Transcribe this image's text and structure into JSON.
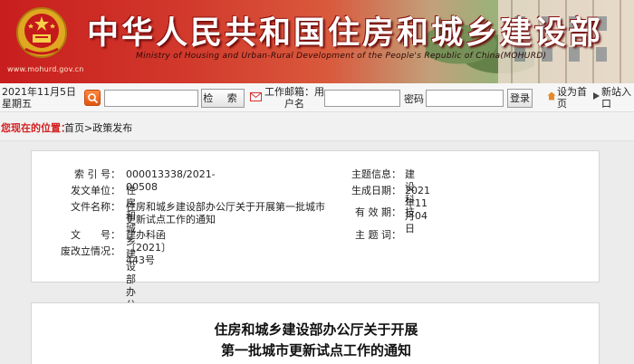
{
  "header": {
    "site_title": "中华人民共和国住房和城乡建设部",
    "site_subtitle": "Ministry of Housing and Urban-Rural Development of the People's Republic of China(MOHURD)",
    "site_url": "www.mohurd.gov.cn"
  },
  "utility_bar": {
    "date": "2021年11月5日 星期五",
    "search_placeholder": "",
    "search_button": "检 索",
    "mail_label": "工作邮箱：用户名",
    "password_label": "密码",
    "login_button": "登录",
    "set_home_label": "设为首页",
    "nav_label": "新站入口"
  },
  "breadcrumb": {
    "label": "您现在的位置：",
    "path": "首页>政策发布"
  },
  "info": {
    "index_key": "索 引 号：",
    "index_value": "000013338/2021-00508",
    "unit_key": "发文单位：",
    "unit_value": "住房和城乡建设部办公厅",
    "title_key": "文件名称：",
    "title_value": "住房和城乡建设部办公厅关于开展第一批城市更新试点工作的通知",
    "docno_key": "文　　号：",
    "docno_value": "建办科函〔2021〕443号",
    "repeal_key": "废改立情况：",
    "repeal_value": "",
    "topic_key": "主题信息：",
    "topic_value": "建设科技",
    "date_key": "生成日期：",
    "date_value": "2021年11月04日",
    "valid_key": "有 效 期：",
    "valid_value": "",
    "keyword_key": "主 题 词：",
    "keyword_value": ""
  },
  "article": {
    "title_line1": "住房和城乡建设部办公厅关于开展",
    "title_line2": "第一批城市更新试点工作的通知"
  },
  "colors": {
    "banner_red": "#c81e1e",
    "breadcrumb_label": "#d42020",
    "search_icon_orange": "#e25410"
  }
}
